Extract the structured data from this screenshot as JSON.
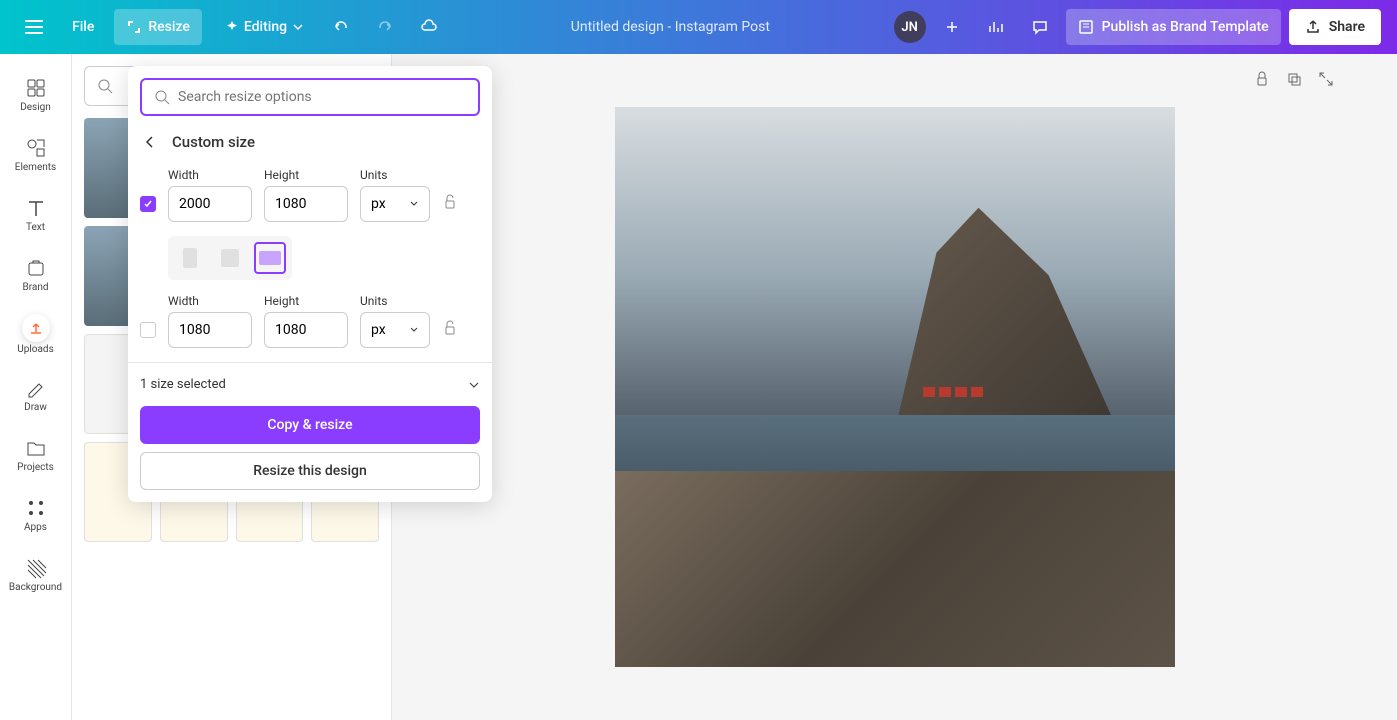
{
  "header": {
    "file": "File",
    "resize": "Resize",
    "editing": "Editing",
    "title": "Untitled design - Instagram Post",
    "avatar": "JN",
    "publish": "Publish as Brand Template",
    "share": "Share"
  },
  "sidebar": {
    "design": "Design",
    "elements": "Elements",
    "text": "Text",
    "brand": "Brand",
    "uploads": "Uploads",
    "draw": "Draw",
    "projects": "Projects",
    "apps": "Apps",
    "background": "Background"
  },
  "popover": {
    "search_placeholder": "Search resize options",
    "title": "Custom size",
    "width_label": "Width",
    "height_label": "Height",
    "units_label": "Units",
    "width1": "2000",
    "height1": "1080",
    "units1": "px",
    "width2": "1080",
    "height2": "1080",
    "units2": "px",
    "size_selected": "1 size selected",
    "copy_resize": "Copy & resize",
    "resize_design": "Resize this design"
  }
}
